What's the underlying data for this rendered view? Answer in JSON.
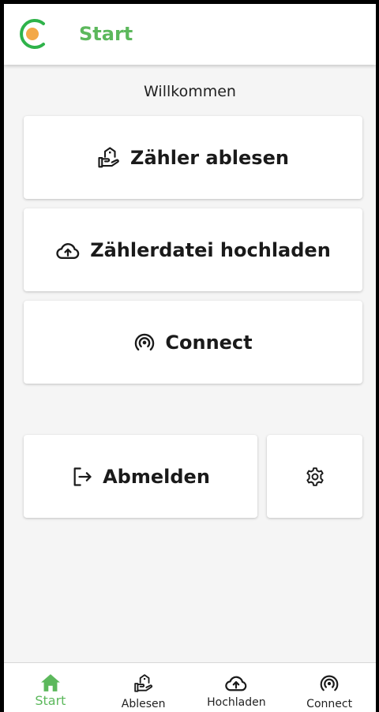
{
  "appbar": {
    "title": "Start",
    "accent_color": "#5cb85c",
    "logo_ring_color": "#2fb34a",
    "logo_dot_color": "#f3a847"
  },
  "main": {
    "welcome": "Willkommen",
    "buttons": {
      "read_meter": {
        "label": "Zähler ablesen",
        "icon": "house-hand-icon"
      },
      "upload_file": {
        "label": "Zählerdatei hochladen",
        "icon": "cloud-upload-icon"
      },
      "connect": {
        "label": "Connect",
        "icon": "broadcast-icon"
      },
      "logout": {
        "label": "Abmelden",
        "icon": "logout-icon"
      },
      "settings": {
        "icon": "gear-icon"
      }
    }
  },
  "bottom_nav": {
    "items": [
      {
        "label": "Start",
        "icon": "home-icon",
        "active": true
      },
      {
        "label": "Ablesen",
        "icon": "house-hand-icon",
        "active": false
      },
      {
        "label": "Hochladen",
        "icon": "cloud-upload-icon",
        "active": false
      },
      {
        "label": "Connect",
        "icon": "broadcast-icon",
        "active": false
      }
    ]
  }
}
